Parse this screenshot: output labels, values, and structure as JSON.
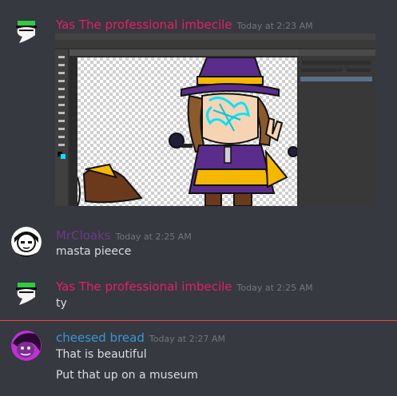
{
  "messages": [
    {
      "author": "Yas The professional imbecile",
      "author_color": "#e91e63",
      "timestamp": "Today at 2:23 AM",
      "text": "",
      "avatar_icon": "green-hat-ghost-icon"
    },
    {
      "author": "MrCloaks",
      "author_color": "#71368a",
      "timestamp": "Today at 2:25 AM",
      "text": "masta pieece",
      "avatar_icon": "black-white-cloak-avatar-icon"
    },
    {
      "author": "Yas The professional imbecile",
      "author_color": "#e91e63",
      "timestamp": "Today at 2:25 AM",
      "text": "ty",
      "avatar_icon": "green-hat-ghost-icon"
    },
    {
      "author": "cheesed bread",
      "author_color": "#3498db",
      "timestamp": "Today at 2:27 AM",
      "text": "That is beautiful",
      "text2": "Put that up on a museum",
      "avatar_icon": "purple-character-avatar-icon"
    }
  ],
  "new_messages_divider_color": "#f04747"
}
